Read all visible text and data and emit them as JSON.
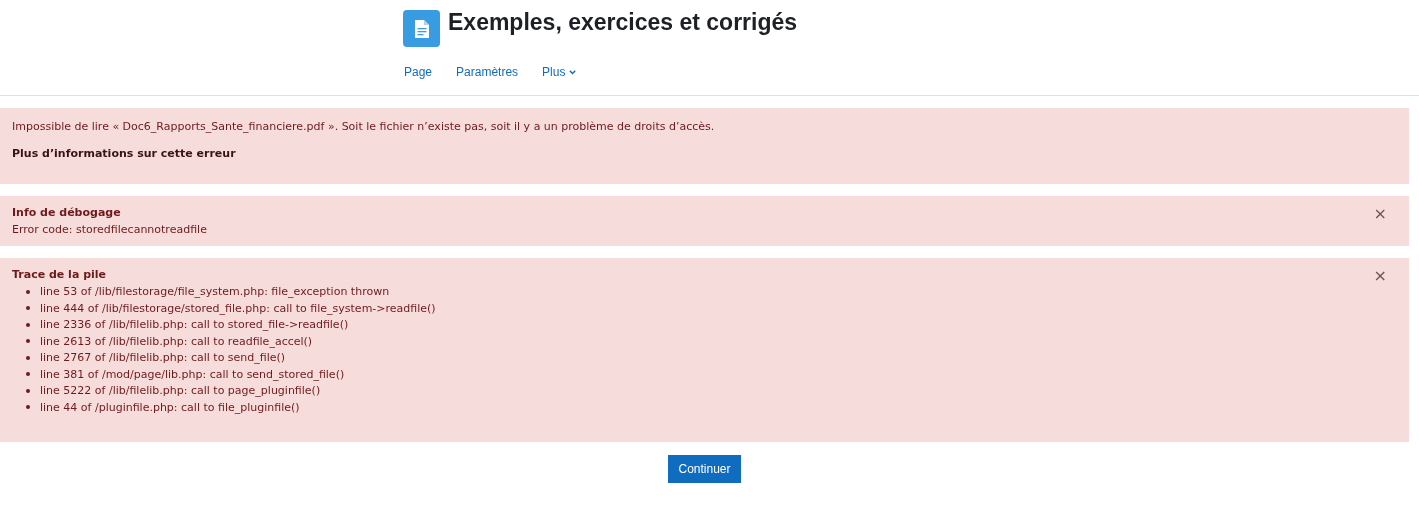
{
  "header": {
    "title": "Exemples, exercices et corrigés"
  },
  "nav": [
    {
      "label": "Page",
      "kind": "link"
    },
    {
      "label": "Paramètres",
      "kind": "link"
    },
    {
      "label": "Plus",
      "kind": "menu"
    }
  ],
  "error": {
    "message": "Impossible de lire « Doc6_Rapports_Sante_financiere.pdf ». Soit le fichier n’existe pas, soit il y a un problème de droits d’accès.",
    "more_link": "Plus d’informations sur cette erreur"
  },
  "debug": {
    "title": "Info de débogage",
    "text": "Error code: storedfilecannotreadfile",
    "close": "×"
  },
  "trace": {
    "title": "Trace de la pile",
    "close": "×",
    "lines": [
      "line 53 of /lib/filestorage/file_system.php: file_exception thrown",
      "line 444 of /lib/filestorage/stored_file.php: call to file_system->readfile()",
      "line 2336 of /lib/filelib.php: call to stored_file->readfile()",
      "line 2613 of /lib/filelib.php: call to readfile_accel()",
      "line 2767 of /lib/filelib.php: call to send_file()",
      "line 381 of /mod/page/lib.php: call to send_stored_file()",
      "line 5222 of /lib/filelib.php: call to page_pluginfile()",
      "line 44 of /pluginfile.php: call to file_pluginfile()"
    ]
  },
  "button": "Continuer"
}
